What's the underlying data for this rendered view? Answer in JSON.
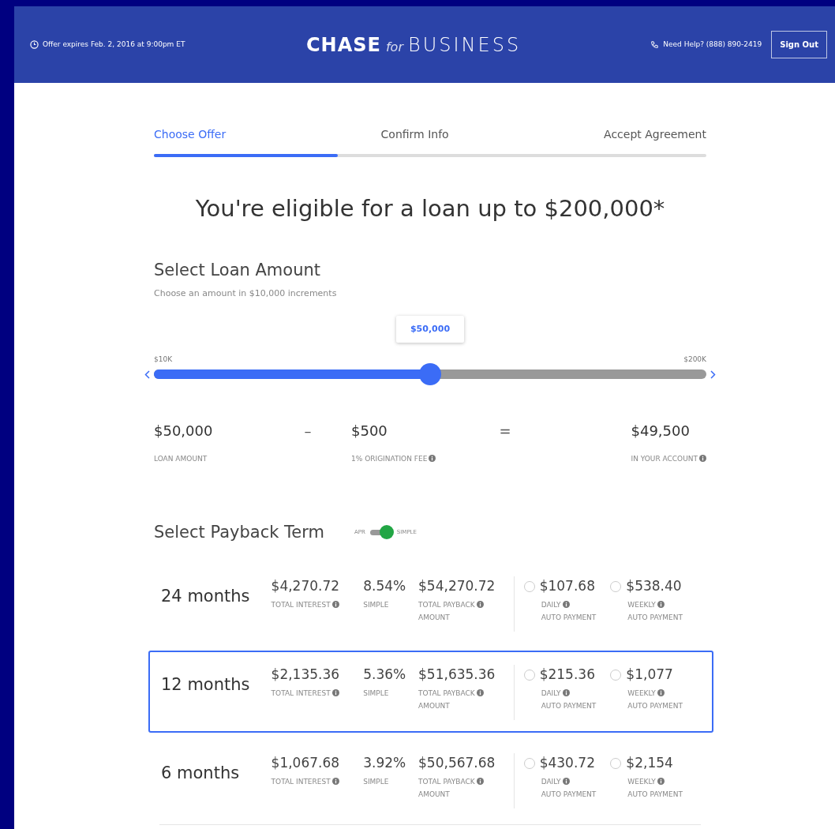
{
  "header": {
    "offer_notice": "Offer expires Feb. 2, 2016 at 9:00pm ET",
    "logo_bold": "CHASE",
    "logo_for": "for",
    "logo_business": "BUSINESS",
    "help": "Need Help? (888) 890-2419",
    "sign_out": "Sign Out"
  },
  "steps": [
    {
      "label": "Choose Offer",
      "selected": true
    },
    {
      "label": "Confirm Info",
      "selected": false
    },
    {
      "label": "Accept Agreement",
      "selected": false
    }
  ],
  "headline": "You're eligible for a loan up to $200,000*",
  "loan": {
    "title": "Select Loan Amount",
    "subtitle": "Choose an amount in $10,000 increments",
    "tooltip": "$50,000",
    "min_label": "$10K",
    "max_label": "$200K",
    "level": 0.5
  },
  "summary": [
    {
      "kind": "value",
      "amount": "$50,000",
      "label": "LOAN AMOUNT",
      "info": false
    },
    {
      "kind": "operator",
      "symbol": "–"
    },
    {
      "kind": "value",
      "amount": "$500",
      "label": "1% ORIGINATION FEE",
      "info": true
    },
    {
      "kind": "operator",
      "symbol": "="
    },
    {
      "kind": "value",
      "amount": "$49,500",
      "label": "IN YOUR ACCOUNT",
      "info": true
    }
  ],
  "payback": {
    "title": "Select Payback Term",
    "toggle_left": "APR",
    "toggle_right": "SIMPLE",
    "toggle_on": true
  },
  "terms": [
    {
      "term": "24 months",
      "interest": "$4,270.72",
      "interest_label": "TOTAL INTEREST",
      "rate": "8.54%",
      "rate_label": "SIMPLE",
      "payback": "$54,270.72",
      "payback_label": "TOTAL PAYBACK",
      "payback_label2": "AMOUNT",
      "daily": "$107.68",
      "daily_label": "DAILY",
      "daily_label2": "AUTO PAYMENT",
      "weekly": "$538.40",
      "weekly_label": "WEEKLY",
      "weekly_label2": "AUTO PAYMENT",
      "selected": false,
      "daily_checked": false,
      "weekly_checked": false
    },
    {
      "term": "12 months",
      "interest": "$2,135.36",
      "interest_label": "TOTAL INTEREST",
      "rate": "5.36%",
      "rate_label": "SIMPLE",
      "payback": "$51,635.36",
      "payback_label": "TOTAL PAYBACK",
      "payback_label2": "AMOUNT",
      "daily": "$215.36",
      "daily_label": "DAILY",
      "daily_label2": "AUTO PAYMENT",
      "weekly": "$1,077",
      "weekly_label": "WEEKLY",
      "weekly_label2": "AUTO PAYMENT",
      "selected": true,
      "daily_checked": false,
      "weekly_checked": false
    },
    {
      "term": "6 months",
      "interest": "$1,067.68",
      "interest_label": "TOTAL INTEREST",
      "rate": "3.92%",
      "rate_label": "SIMPLE",
      "payback": "$50,567.68",
      "payback_label": "TOTAL PAYBACK",
      "payback_label2": "AMOUNT",
      "daily": "$430.72",
      "daily_label": "DAILY",
      "daily_label2": "AUTO PAYMENT",
      "weekly": "$2,154",
      "weekly_label": "WEEKLY",
      "weekly_label2": "AUTO PAYMENT",
      "selected": false,
      "daily_checked": false,
      "weekly_checked": false
    }
  ]
}
